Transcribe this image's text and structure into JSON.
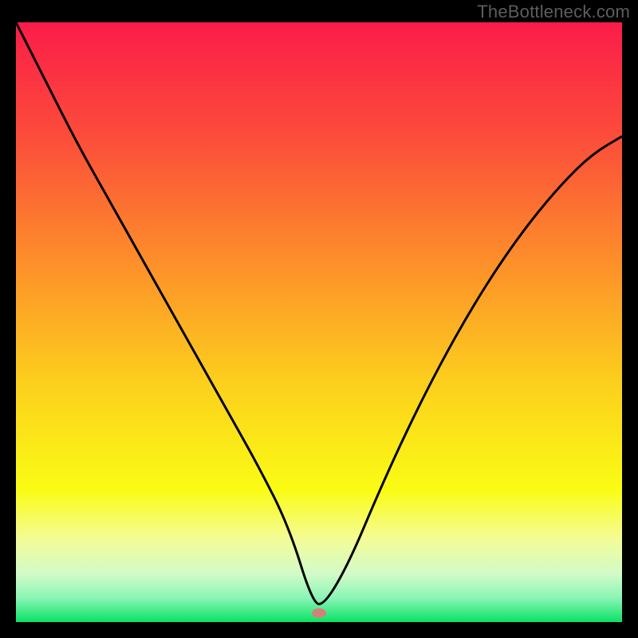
{
  "watermark": "TheBottleneck.com",
  "chart_data": {
    "type": "line",
    "title": "",
    "xlabel": "",
    "ylabel": "",
    "xlim": [
      0,
      100
    ],
    "ylim": [
      0,
      100
    ],
    "grid": false,
    "legend": false,
    "series": [
      {
        "name": "bottleneck-curve",
        "x": [
          0,
          5,
          10,
          15,
          20,
          25,
          30,
          35,
          40,
          45,
          49,
          51,
          55,
          60,
          65,
          70,
          75,
          80,
          85,
          90,
          95,
          100
        ],
        "y": [
          100,
          90,
          80,
          71,
          62,
          53,
          44,
          35,
          26,
          16,
          3,
          3,
          10,
          22,
          33,
          43,
          52,
          60,
          67,
          73,
          78,
          81
        ]
      }
    ],
    "marker": {
      "x": 50,
      "y": 1.5,
      "color": "#d5817b"
    },
    "background_gradient": {
      "stops": [
        {
          "offset": 0.0,
          "color": "#fb1c49"
        },
        {
          "offset": 0.2,
          "color": "#fc4f3a"
        },
        {
          "offset": 0.4,
          "color": "#fd8f2a"
        },
        {
          "offset": 0.6,
          "color": "#fccf1d"
        },
        {
          "offset": 0.78,
          "color": "#fafc14"
        },
        {
          "offset": 0.86,
          "color": "#f4fc95"
        },
        {
          "offset": 0.92,
          "color": "#d2fbc9"
        },
        {
          "offset": 0.96,
          "color": "#8af5b5"
        },
        {
          "offset": 1.0,
          "color": "#0ae264"
        }
      ]
    }
  }
}
